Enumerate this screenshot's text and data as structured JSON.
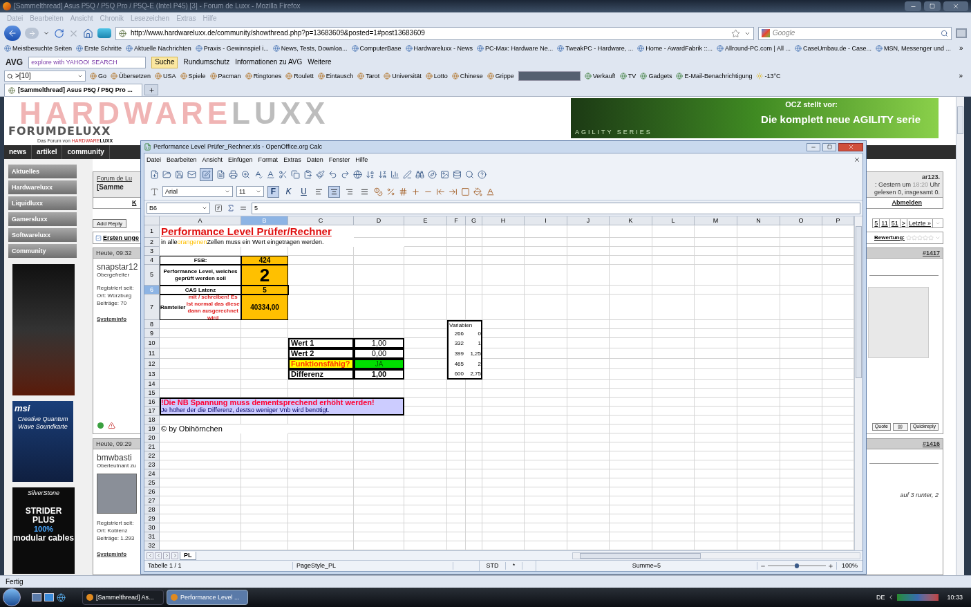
{
  "browser": {
    "title": "[Sammelthread] Asus P5Q / P5Q Pro / P5Q-E (Intel P45) [3] - Forum de Luxx - Mozilla Firefox",
    "menu": [
      "Datei",
      "Bearbeiten",
      "Ansicht",
      "Chronik",
      "Lesezeichen",
      "Extras",
      "Hilfe"
    ],
    "url": "http://www.hardwareluxx.de/community/showthread.php?p=13683609&posted=1#post13683609",
    "search_placeholder": "Google",
    "bookmarks": [
      "Meistbesuchte Seiten",
      "Erste Schritte",
      "Aktuelle Nachrichten",
      "Praxis - Gewinnspiel i...",
      "News, Tests, Downloa...",
      "ComputerBase",
      "Hardwareluxx - News",
      "PC-Max: Hardware Ne...",
      "TweakPC - Hardware, ...",
      "Home - AwardFabrik ::...",
      "Allround-PC.com | All ...",
      "CaseUmbau.de - Case...",
      "MSN, Messenger und ..."
    ],
    "bookmarks_more": "»",
    "avg": {
      "logo": "AVG",
      "search_placeholder": "explore with YAHOO! SEARCH",
      "search_button": "Suche",
      "items": [
        "Rundumschutz",
        "Informationen zu AVG",
        "Weitere"
      ]
    },
    "toolbar": {
      "field": ">[10]",
      "items": [
        "Go",
        "Übersetzen",
        "USA",
        "Spiele",
        "Pacman",
        "Ringtones",
        "Roulett",
        "Eintausch",
        "Tarot",
        "Universität",
        "Lotto",
        "Chinese",
        "Grippe"
      ],
      "items_after": [
        "Verkauf!",
        "TV",
        "Gadgets",
        "E-Mail-Benachrichtigung"
      ],
      "weather": "-13°C",
      "more": "»"
    },
    "tabs": [
      {
        "label": "[Sammelthread] Asus P5Q / P5Q Pro ...",
        "selected": true
      }
    ],
    "status": "Fertig"
  },
  "forum": {
    "banner_parts": [
      {
        "kind": "accent",
        "text": "HARDWARE"
      },
      {
        "kind": "plain",
        "text": "LUXX"
      }
    ],
    "logo": "FORUMDELUXX",
    "tagline_parts": [
      {
        "kind": "plain",
        "text": "Das Forum von "
      },
      {
        "kind": "accent",
        "text": "HARDWARE"
      },
      {
        "kind": "strong",
        "text": "LUXX"
      }
    ],
    "ad": {
      "kicker": "OCZ stellt vor:",
      "headline": "Die komplett neue AGILITY serie",
      "series": "AGILITY SERIES"
    },
    "nav": [
      "news",
      "artikel",
      "community"
    ],
    "sidebar": [
      "Aktuelles",
      "Hardwareluxx",
      "Liquidluxx",
      "Gamersluxx",
      "Softwareluxx",
      "Community"
    ],
    "msi_ad": {
      "brand": "msi",
      "text": "Creative Quantum Wave Soundkarte"
    },
    "silverstone_ad": {
      "brand": "SilverStone",
      "lines": [
        "STRIDER",
        "PLUS",
        "100%",
        "modular cables"
      ]
    },
    "breadcrumb": {
      "link": "Forum de Lu",
      "thread": "[Samme"
    },
    "user_panel": {
      "name": "ar123.",
      "visit_parts": [
        {
          "kind": "plain",
          "text": ": Gestern um "
        },
        {
          "kind": "muted",
          "text": "18:20"
        },
        {
          "kind": "plain",
          "text": " Uhr"
        }
      ],
      "messages": "gelesen 0, insgesamt 0."
    },
    "nav_fragment": "K",
    "logout": "Abmelden",
    "add_reply": "Add Reply",
    "pages": [
      "5",
      "11",
      "51",
      ">",
      "Letzte »"
    ],
    "first_unread": "Ersten unge",
    "rating_label": "Bewertung:",
    "stars": 0,
    "posts": [
      {
        "time": "Heute, 09:32",
        "number": "#1417",
        "user": "snapstar12",
        "rank": "Obergefreiter",
        "avatar": false,
        "info": [
          "Registriert seit:",
          "Ort: Würzburg",
          "Beiträge: 70"
        ],
        "systeminfo": "Systeminfo",
        "actions": [
          "Quote",
          "Quickreply"
        ]
      },
      {
        "time": "Heute, 09:29",
        "number": "#1416",
        "user": "bmwbasti",
        "rank": "Oberleutnant zu",
        "avatar": true,
        "info": [
          "Registriert seit:",
          "Ort: Koblenz",
          "Beiträge: 1.293"
        ],
        "systeminfo": "Systeminfo",
        "excerpt": "auf 3 runter, 2"
      }
    ]
  },
  "calc": {
    "title": "Performance Level Prüfer_Rechner.xls - OpenOffice.org Calc",
    "menu": [
      "Datei",
      "Bearbeiten",
      "Ansicht",
      "Einfügen",
      "Format",
      "Extras",
      "Daten",
      "Fenster",
      "Hilfe"
    ],
    "edit_mode": true,
    "font": "Arial",
    "size": "11",
    "format_buttons": [
      {
        "label": "F",
        "pressed": true
      },
      {
        "label": "K",
        "pressed": false
      },
      {
        "label": "U",
        "pressed": false
      }
    ],
    "align_buttons": [
      {
        "kind": "left",
        "pressed": false
      },
      {
        "kind": "center",
        "pressed": true
      },
      {
        "kind": "right",
        "pressed": false
      },
      {
        "kind": "justify",
        "pressed": false
      }
    ],
    "cell_ref": "B6",
    "formula": "5",
    "columns": [
      {
        "label": "A",
        "selected": false
      },
      {
        "label": "B",
        "selected": true
      },
      {
        "label": "C",
        "selected": false
      },
      {
        "label": "D",
        "selected": false
      },
      {
        "label": "E",
        "selected": false
      },
      {
        "label": "F",
        "selected": false
      },
      {
        "label": "G",
        "selected": false
      },
      {
        "label": "H",
        "selected": false
      },
      {
        "label": "I",
        "selected": false
      },
      {
        "label": "J",
        "selected": false
      },
      {
        "label": "K",
        "selected": false
      },
      {
        "label": "L",
        "selected": false
      },
      {
        "label": "M",
        "selected": false
      },
      {
        "label": "N",
        "selected": false
      },
      {
        "label": "O",
        "selected": false
      },
      {
        "label": "P",
        "selected": false
      }
    ],
    "rows": [
      {
        "label": "1",
        "selected": false,
        "cells": [
          {
            "kind": "title",
            "text": "Performance Level Prüfer/Rechner"
          }
        ]
      },
      {
        "label": "2",
        "selected": false,
        "cells": [
          {
            "kind": "note",
            "parts": [
              {
                "kind": "plain",
                "text": "in alle "
              },
              {
                "kind": "highlight",
                "text": "orangenen"
              },
              {
                "kind": "plain",
                "text": " Zellen muss ein Wert eingetragen werden."
              }
            ]
          }
        ]
      },
      {
        "label": "3",
        "selected": false,
        "cells": []
      },
      {
        "label": "4",
        "selected": false,
        "cells": [
          {
            "kind": "label",
            "text": "FSB:"
          },
          {
            "kind": "input",
            "text": "424"
          }
        ]
      },
      {
        "label": "5",
        "selected": false,
        "cells": [
          {
            "kind": "label",
            "text": "Performance Level, welches geprüft werden soll"
          },
          {
            "kind": "input-large",
            "text": "2"
          }
        ]
      },
      {
        "label": "6",
        "selected": true,
        "cells": [
          {
            "kind": "label",
            "text": "CAS Latenz"
          },
          {
            "kind": "input",
            "text": "5"
          }
        ]
      },
      {
        "label": "7",
        "selected": false,
        "cells": [
          {
            "kind": "label",
            "parts": [
              {
                "kind": "plain",
                "text": "Ramteiler "
              },
              {
                "kind": "alert",
                "text": "mit / schreiben! Es ist normal das diese dann ausgerechnet wird"
              }
            ]
          },
          {
            "kind": "input",
            "text": "40334,00"
          }
        ]
      },
      {
        "label": "8",
        "selected": false,
        "cells": [
          null,
          null,
          null,
          null,
          null,
          {
            "kind": "variable-heading",
            "text": "Variablen"
          }
        ]
      },
      {
        "label": "9",
        "selected": false,
        "cells": [
          null,
          null,
          null,
          null,
          null,
          {
            "kind": "variable-left",
            "text": "266"
          },
          {
            "kind": "variable-right",
            "text": "0"
          }
        ]
      },
      {
        "label": "10",
        "selected": false,
        "cells": [
          null,
          null,
          {
            "kind": "box-label",
            "text": "Wert 1"
          },
          {
            "kind": "box-value",
            "text": "1,00"
          },
          null,
          {
            "kind": "variable-left",
            "text": "332"
          },
          {
            "kind": "variable-right",
            "text": "1"
          }
        ]
      },
      {
        "label": "11",
        "selected": false,
        "cells": [
          null,
          null,
          {
            "kind": "box-label",
            "text": "Wert 2"
          },
          {
            "kind": "box-value",
            "text": "0,00"
          },
          null,
          {
            "kind": "variable-left",
            "text": "399"
          },
          {
            "kind": "variable-right",
            "text": "1,25"
          }
        ]
      },
      {
        "label": "12",
        "selected": false,
        "cells": [
          null,
          null,
          {
            "kind": "box-warning",
            "text": "Funktionsfähig?"
          },
          {
            "kind": "box-ok",
            "text": "JA"
          },
          null,
          {
            "kind": "variable-left",
            "text": "465"
          },
          {
            "kind": "variable-right",
            "text": "2"
          }
        ]
      },
      {
        "label": "13",
        "selected": false,
        "cells": [
          null,
          null,
          {
            "kind": "box-label",
            "text": "Differenz"
          },
          {
            "kind": "box-value-bold",
            "text": "1,00"
          },
          null,
          {
            "kind": "variable-left-last",
            "text": "600"
          },
          {
            "kind": "variable-right-last",
            "text": "2,75"
          }
        ]
      },
      {
        "label": "14",
        "selected": false,
        "cells": []
      },
      {
        "label": "15",
        "selected": false,
        "cells": []
      },
      {
        "label": "16",
        "selected": false,
        "cells": [
          {
            "kind": "banner-heading",
            "text": "!Die NB Spannung muss dementsprechend erhöht werden!"
          }
        ]
      },
      {
        "label": "17",
        "selected": false,
        "cells": [
          {
            "kind": "banner-text",
            "text": "Je höher der die Differenz, destso weniger Vnb wird benötigt."
          }
        ]
      },
      {
        "label": "18",
        "selected": false,
        "cells": []
      },
      {
        "label": "19",
        "selected": false,
        "cells": [
          {
            "kind": "credit",
            "text": "© by Obihörnchen"
          }
        ]
      },
      {
        "label": "20",
        "selected": false,
        "cells": []
      },
      {
        "label": "21",
        "selected": false,
        "cells": []
      },
      {
        "label": "22",
        "selected": false,
        "cells": []
      },
      {
        "label": "23",
        "selected": false,
        "cells": []
      },
      {
        "label": "24",
        "selected": false,
        "cells": []
      },
      {
        "label": "25",
        "selected": false,
        "cells": []
      },
      {
        "label": "26",
        "selected": false,
        "cells": []
      },
      {
        "label": "27",
        "selected": false,
        "cells": []
      },
      {
        "label": "28",
        "selected": false,
        "cells": []
      },
      {
        "label": "29",
        "selected": false,
        "cells": []
      },
      {
        "label": "30",
        "selected": false,
        "cells": []
      },
      {
        "label": "31",
        "selected": false,
        "cells": []
      },
      {
        "label": "32",
        "selected": false,
        "cells": []
      }
    ],
    "sheet_tabs": [
      {
        "label": "PL",
        "selected": true
      }
    ],
    "status": {
      "sheet": "Tabelle 1 / 1",
      "page_style": "PageStyle_PL",
      "mode": "STD",
      "modified": "*",
      "sum": "Summe=5",
      "zoom": {
        "level": 0.5,
        "reading": "100%"
      }
    }
  },
  "taskbar": {
    "tasks": [
      {
        "label": "[Sammelthread] As...",
        "selected": false
      },
      {
        "label": "Performance Level ...",
        "selected": true
      }
    ],
    "language": "DE",
    "clock": "10:33"
  }
}
